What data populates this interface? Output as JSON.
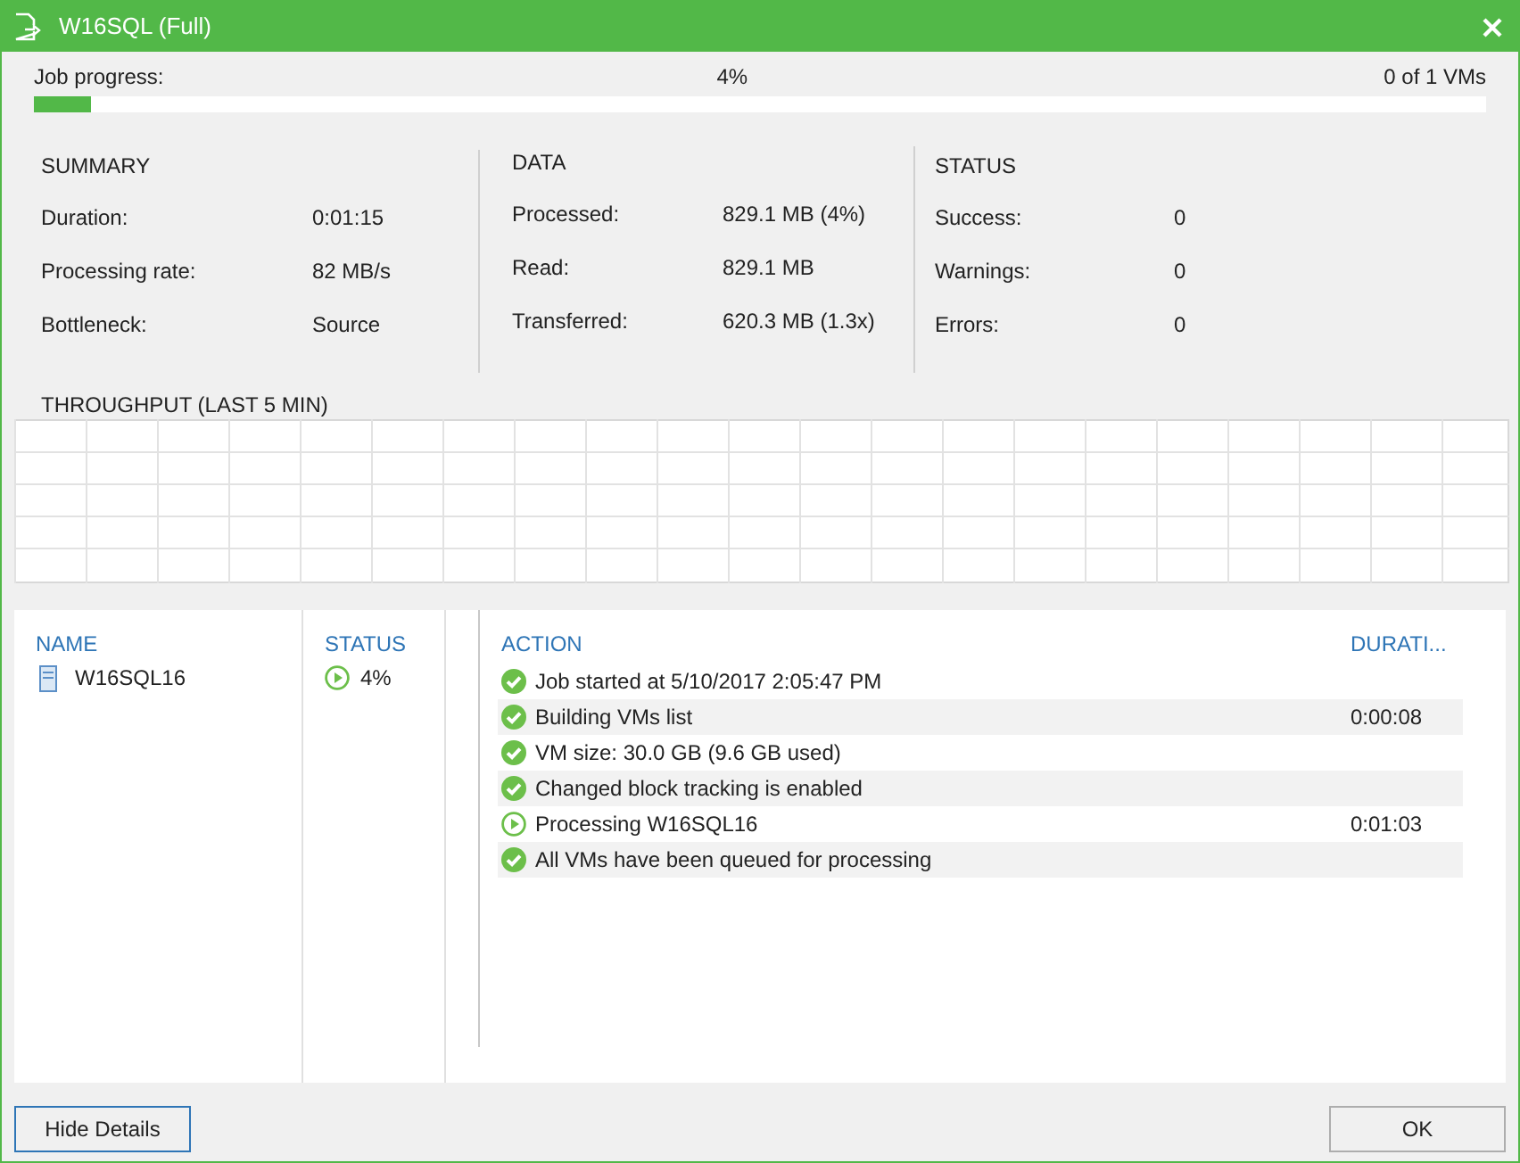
{
  "window": {
    "title": "W16SQL (Full)"
  },
  "progress": {
    "label": "Job progress:",
    "percent": "4%",
    "count": "0 of 1 VMs",
    "level": 0.04
  },
  "summary": {
    "title": "SUMMARY",
    "rows": [
      {
        "label": "Duration:",
        "value": "0:01:15"
      },
      {
        "label": "Processing rate:",
        "value": "82 MB/s"
      },
      {
        "label": "Bottleneck:",
        "value": "Source"
      }
    ]
  },
  "data": {
    "title": "DATA",
    "rows": [
      {
        "label": "Processed:",
        "value": "829.1 MB (4%)"
      },
      {
        "label": "Read:",
        "value": "829.1 MB"
      },
      {
        "label": "Transferred:",
        "value": "620.3 MB (1.3x)"
      }
    ]
  },
  "status": {
    "title": "STATUS",
    "rows": [
      {
        "label": "Success:",
        "value": "0"
      },
      {
        "label": "Warnings:",
        "value": "0"
      },
      {
        "label": "Errors:",
        "value": "0"
      }
    ]
  },
  "throughput": {
    "title": "THROUGHPUT (LAST 5 MIN)"
  },
  "vms": {
    "columns": [
      "NAME",
      "STATUS"
    ],
    "rows": [
      {
        "name": "W16SQL16",
        "status": "4%",
        "kind": "running"
      }
    ]
  },
  "actions": {
    "columns": [
      "ACTION",
      "DURATI..."
    ],
    "rows": [
      {
        "text": "Job started at 5/10/2017 2:05:47 PM",
        "duration": "",
        "kind": "done"
      },
      {
        "text": "Building VMs list",
        "duration": "0:00:08",
        "kind": "done"
      },
      {
        "text": "VM size: 30.0 GB (9.6 GB used)",
        "duration": "",
        "kind": "done"
      },
      {
        "text": "Changed block tracking is enabled",
        "duration": "",
        "kind": "done"
      },
      {
        "text": "Processing W16SQL16",
        "duration": "0:01:03",
        "kind": "running"
      },
      {
        "text": "All VMs have been queued for processing",
        "duration": "",
        "kind": "done"
      }
    ]
  },
  "buttons": {
    "left": "Hide Details",
    "right": "OK"
  }
}
